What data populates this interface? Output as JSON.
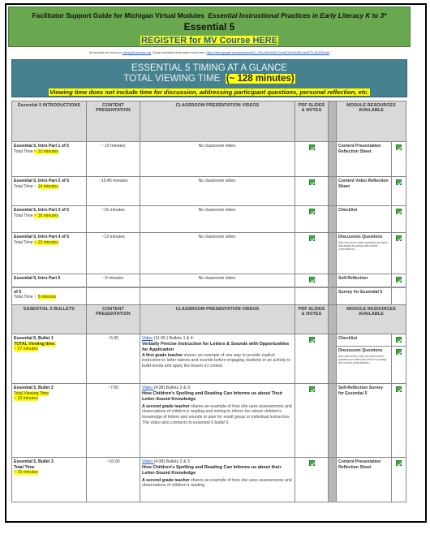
{
  "header": {
    "prefix": "Facilitator Support Guide for Michigan Virtual Modules",
    "italic_title": "Essential Instructional Practices in Early Literacy K to 3*",
    "essential": "Essential 5",
    "register_link": "REGISTER for MV Course HERE"
  },
  "notice": {
    "text1": "All modules are found on ",
    "link1": "LiteracyEssentials.org",
    "text2": ". Group enrollment information found here: ",
    "link2": "https://docs.google.com/document/d/1_zPhLA8YaX4kO-NmiEOzVfmDNfLHpOETIL4iD2Oh/edit"
  },
  "glance": {
    "title": "ESSENTIAL 5 TIMING AT A GLANCE",
    "total_label": "TOTAL VIEWING TIME",
    "total_value": "(~ 128 minutes)",
    "note": "Viewing time does not include time for discussion, addressing participant questions, personal reflection, etc."
  },
  "intro_header": {
    "col1": "Essential 5 INTRODUCTIONS",
    "col2": "CONTENT PRESENTATION",
    "col3": "CLASSROOM PRESENTATION VIDEOS",
    "col4": "PDF SLIDES & NOTES",
    "col5": "MODULE RESOURCES AVAILABLE"
  },
  "intro_rows": [
    {
      "title": "Essential 5, Intro Part 1 of 5",
      "total_label": "Total Time ",
      "total_value": "~ 10 minutes",
      "content": "~ 10 minutes",
      "video": "No classroom video.",
      "resource": "Content Presentation Reflection Sheet"
    },
    {
      "title": "Essential 5, Intro Part 2 of 5",
      "total_label": "Total Time ~ ",
      "total_value": "14 minutes",
      "content": "~13:45 minutes",
      "video": "No classroom video.",
      "resource": "Content Video Reflection Sheet"
    },
    {
      "title": "Essential 5, Intro Part 3 of 5",
      "total_label": "Total Time ",
      "total_value": "~ 16 minutes",
      "content": "~16 minutes",
      "video": "No classroom video.",
      "resource": "Checklist"
    },
    {
      "title": "Essential 5, Intro Part 4 of 5",
      "total_label": "Total Time ",
      "total_value": "~ 13 minutes",
      "content": "~13 minutes",
      "video": "No classroom video.",
      "resource": "Discussion Questions",
      "resource_note": "(See also below where questions are listed with advice for pairing with module presentations.)"
    },
    {
      "title": "Essential 5, Intro Part 5",
      "content": "~3 minutes",
      "video": "No classroom video.",
      "resource": "Self-Reflection"
    }
  ],
  "intro_continuation": {
    "title": "of 5",
    "total_label": "Total Time ~ ",
    "total_value": "5 minutes",
    "resource": "Survey for Essential 5"
  },
  "bullets_header": {
    "col1": "ESSENTIAL 5 BULLETS",
    "col2": "CONTENT PRESENTATION",
    "col3": "CLASSROOM PRESENTATION VIDEOS",
    "col4": "PDF SLIDES & NOTES",
    "col5": "MODULE RESOURCES AVAILABLE"
  },
  "bullet_rows": [
    {
      "title": "Essential 5, Bullet 1",
      "total_line1": "TOTAL Viewing time:",
      "total_line2": "~ 17 minutes",
      "content": "~5:30",
      "video_link": "Video",
      "video_meta": " (11:35 ) Bullets 1 & 4:",
      "video_title": "Verbally Precise Instruction for Letters & Sounds with Opportunities for Application",
      "desc_bold": "A first grade teacher",
      "desc": " shares an example of one way to provide explicit instruction in letter names and sounds before engaging students in an activity to build words and apply the lesson in context.",
      "resources": [
        {
          "label": "Checklist"
        },
        {
          "label": "Discussion Questions",
          "note": "(See also below in this document  where questions are listed with advice for pairing with module presentations.)"
        }
      ]
    },
    {
      "title": "Essential 5, Bullet 2",
      "total_line1": "Total Viewing Time",
      "total_line2": "~ 12 minutes",
      "content": "~7:00",
      "video_link": "Video ",
      "video_meta": "(4:38) Bullets 2 & 3:",
      "video_title": "How Children's Spelling and Reading Can Informs us about Their Letter-Sound Knowledge",
      "desc_bold": "A second grade teacher",
      "desc": " shares an example of how she uses assessments and observations of children's reading and writing to inform her about children's knowledge of letters and sounds to plan for small group or individual instruction.",
      "note": "The video also connects to essential 6 bullet 5.",
      "resources": [
        {
          "label": "Self-Reflection Survey for Essential 5"
        }
      ]
    },
    {
      "title": "Essential 5, Bullet 3",
      "total_line1": "Total Time",
      "total_line2": "~ 15 minutes",
      "content": "~10:00",
      "video_link": "Video ",
      "video_meta": "(4:38) Bullets 2 & 3",
      "video_title": "How Children's Spelling and Reading Can Informs us about their Letter-Sound Knowledge",
      "desc_bold": "A second grade teacher",
      "desc": " shares an example of how she uses assessments and observations of children's reading",
      "resources": [
        {
          "label": "Content Presentation Reflection Sheet"
        }
      ]
    }
  ],
  "colors": {
    "header_green": "#6aa84f",
    "glance_teal": "#45818e",
    "highlight_yellow": "#ffff00",
    "check_green": "#3cb043",
    "link_blue": "#1155cc"
  }
}
